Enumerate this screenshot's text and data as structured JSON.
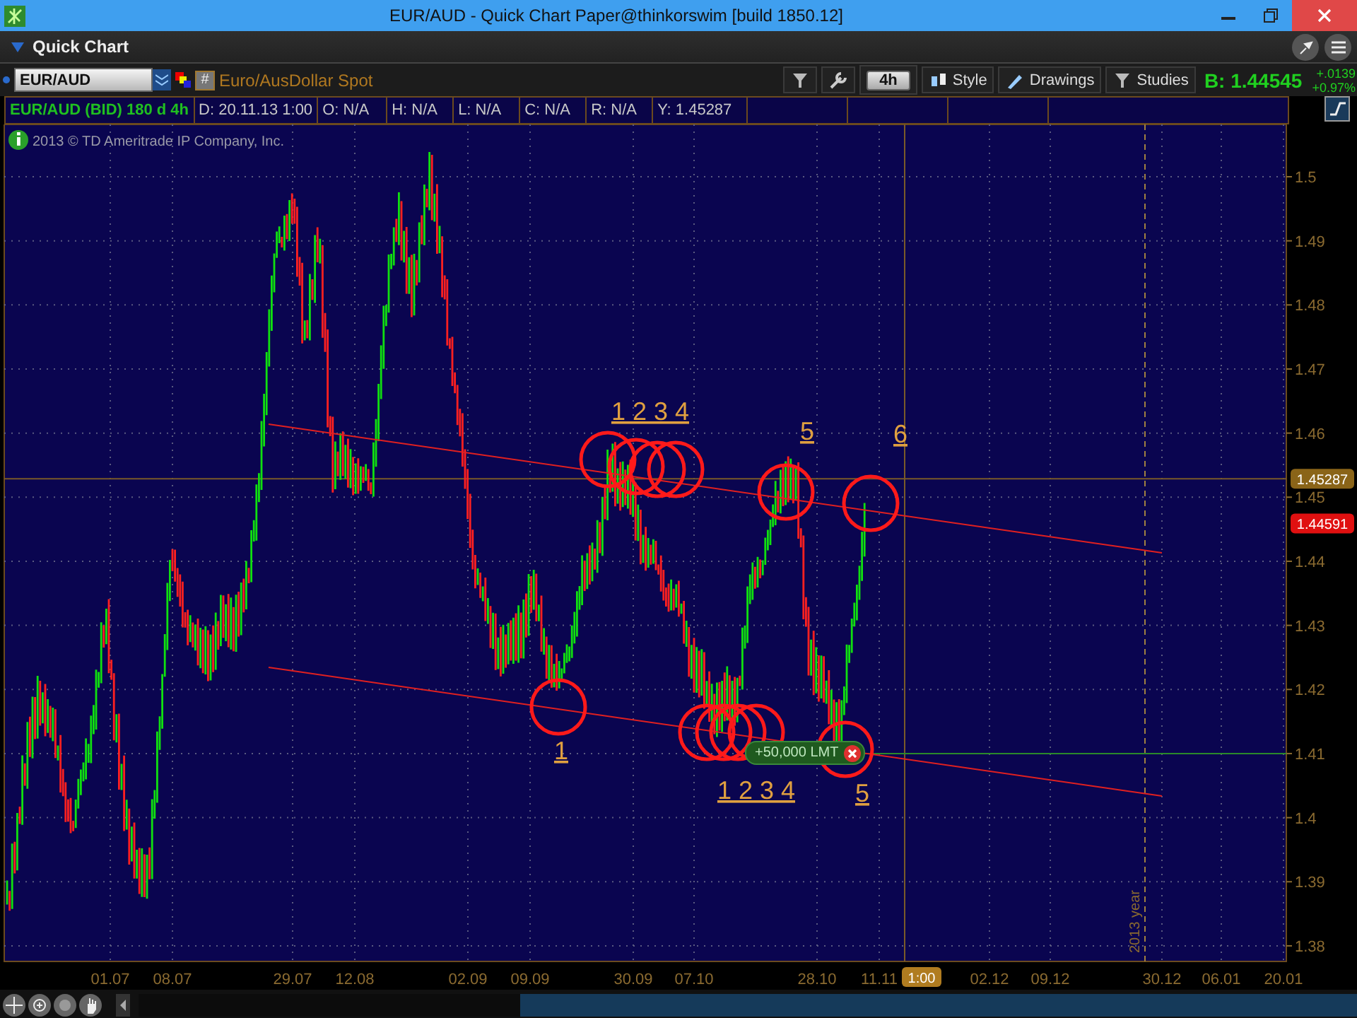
{
  "window": {
    "title": "EUR/AUD - Quick Chart Paper@thinkorswim [build 1850.12]"
  },
  "panel": {
    "title": "Quick Chart"
  },
  "toolbar": {
    "symbol": "EUR/AUD",
    "hash_button": "#",
    "description": "Euro/AusDollar Spot",
    "aggregation": "4h",
    "buttons": [
      {
        "label": "Style",
        "kind": "style"
      },
      {
        "label": "Drawings",
        "kind": "drawings"
      },
      {
        "label": "Studies",
        "kind": "studies"
      }
    ],
    "bid": "B: 1.44545",
    "change": "+.0139",
    "change_percent": "+0.97%"
  },
  "info_bar": {
    "title": "EUR/AUD (BID) 180 d 4h",
    "cells": [
      "D: 20.11.13 1:00",
      "O: N/A",
      "H: N/A",
      "L: N/A",
      "C: N/A",
      "R: N/A",
      "Y: 1.45287"
    ]
  },
  "chart": {
    "copyright": "2013 © TD Ameritrade IP Company, Inc.",
    "price_labels": [
      "1.5",
      "1.49",
      "1.48",
      "1.47",
      "1.46",
      "1.45",
      "1.44",
      "1.43",
      "1.42",
      "1.41",
      "1.4",
      "1.39",
      "1.38"
    ],
    "date_labels": [
      "01.07",
      "08.07",
      "29.07",
      "12.08",
      "02.09",
      "09.09",
      "30.09",
      "07.10",
      "28.10",
      "11.11",
      "02.12",
      "09.12",
      "30.12",
      "06.01",
      "20.01"
    ],
    "cursor_time": "1:00",
    "year_marker": "2013 year",
    "cursor_price": "1.45287",
    "last_price": "1.44591",
    "order": "+50,000 LMT",
    "annotations": [
      "1 2 3 4",
      "5",
      "6",
      "1",
      "1 2 3 4",
      "5"
    ]
  }
}
